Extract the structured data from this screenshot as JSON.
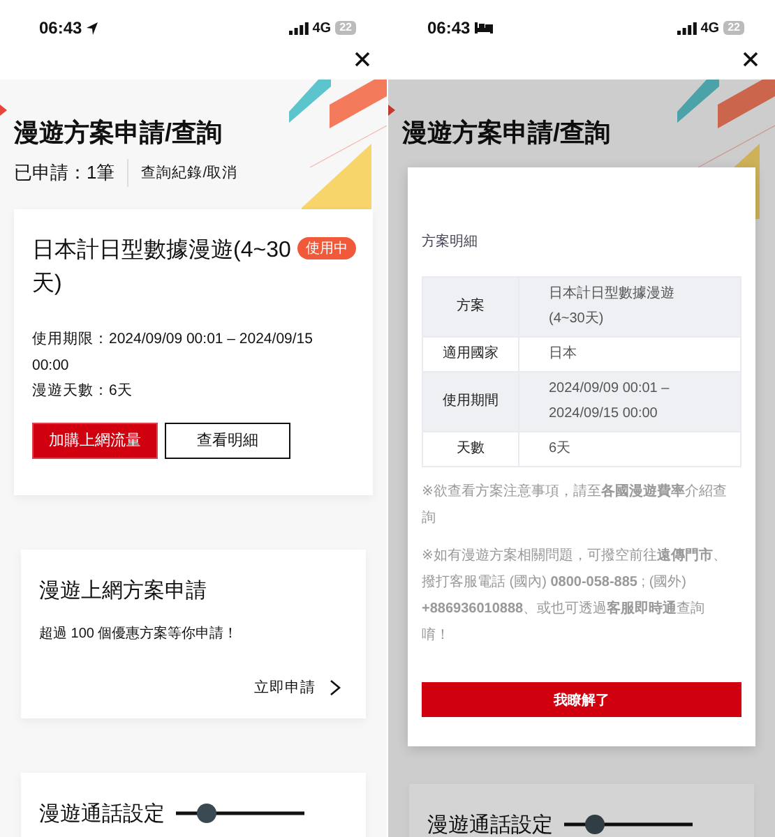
{
  "screens": [
    {
      "status_bar": {
        "time": "06:43",
        "network": "4G",
        "battery": "22"
      },
      "title": "漫遊方案申請/查詢",
      "summary": {
        "count": "已申請：1筆",
        "link": "查詢紀錄/取消"
      },
      "plan_card": {
        "name": "日本計日型數據漫遊(4~30天)",
        "badge": "使用中",
        "period": "使用期限：2024/09/09 00:01 – 2024/09/15 00:00",
        "days": "漫遊天數：6天",
        "buttons": [
          "加購上網流量",
          "查看明細"
        ]
      },
      "apply_card": {
        "title": "漫遊上網方案申請",
        "text": "超過 100 個優惠方案等你申請！",
        "link": "立即申請"
      },
      "call_card": {
        "title": "漫遊通話設定"
      }
    },
    {
      "status_bar": {
        "time": "06:43",
        "network": "4G",
        "battery": "22"
      },
      "title": "漫遊方案申請/查詢",
      "call_card": {
        "title": "漫遊通話設定"
      },
      "dialog": {
        "heading": "方案明細",
        "rows": [
          {
            "label": "方案",
            "value": "日本計日型數據漫遊(4~30天)"
          },
          {
            "label": "適用國家",
            "value": "日本"
          },
          {
            "label": "使用期間",
            "value": "2024/09/09 00:01 – 2024/09/15 00:00"
          },
          {
            "label": "天數",
            "value": "6天"
          }
        ],
        "notes": [
          "※欲查看方案注意事項，請至**各國漫遊費率**介紹查詢",
          "※如有漫遊方案相關問題，可撥空前往**遠傳門市**、撥打客服電話 (國內) **0800-058-885** ; (國外) **+886936010888**、或也可透過**客服即時通**查詢唷！"
        ],
        "button": "我瞭解了"
      }
    }
  ]
}
